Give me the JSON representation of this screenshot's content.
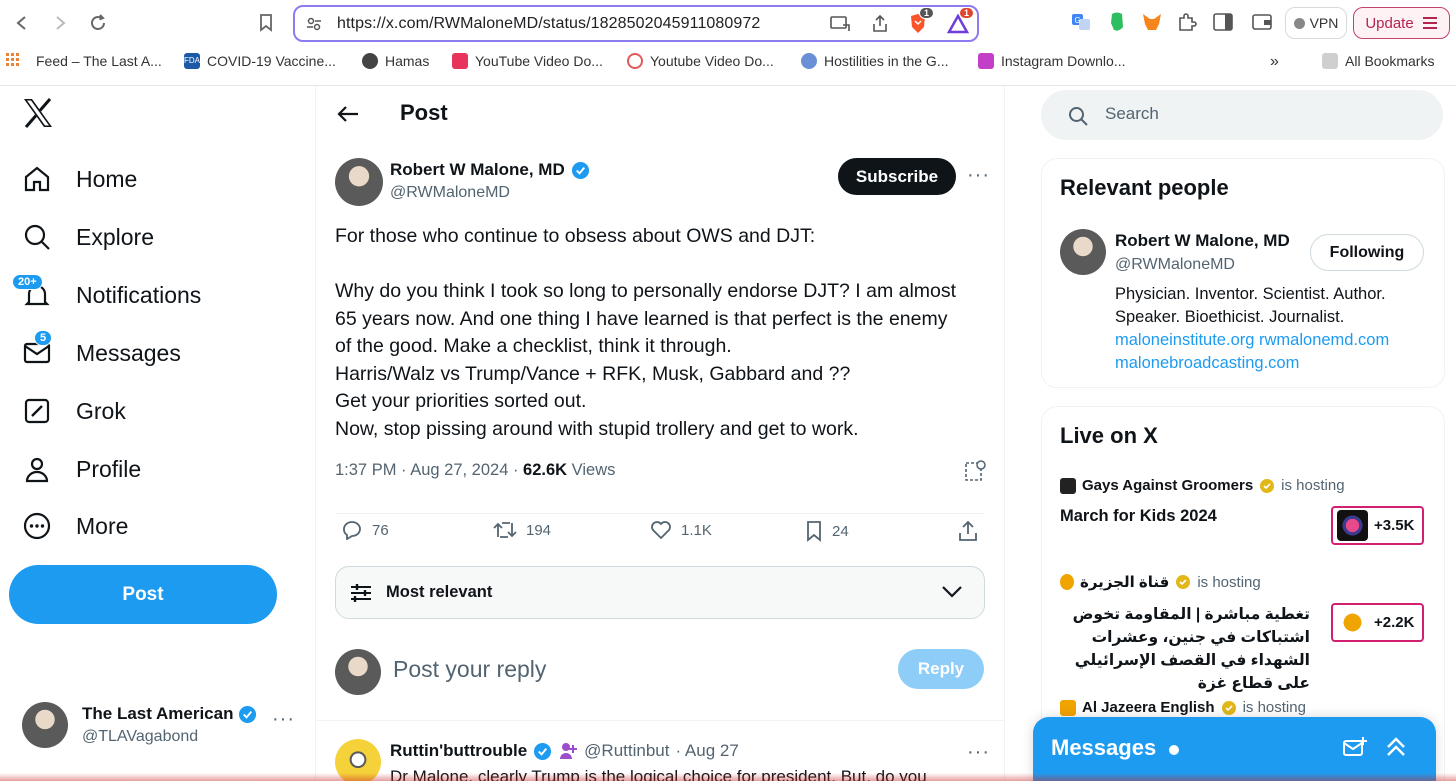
{
  "browser": {
    "url": "https://x.com/RWMaloneMD/status/1828502045911080972",
    "vpn_label": "VPN",
    "update_label": "Update",
    "brave_badge": "1",
    "rewards_badge": "1",
    "bookmarks": [
      {
        "label": "Feed – The Last A...",
        "color": "#e8833a"
      },
      {
        "label": "COVID-19 Vaccine...",
        "color": "#1c5aa6"
      },
      {
        "label": "Hamas",
        "color": "#444444"
      },
      {
        "label": "YouTube Video Do...",
        "color": "#e8335a"
      },
      {
        "label": "Youtube Video Do...",
        "color": "#e05a5a"
      },
      {
        "label": "Hostilities in the G...",
        "color": "#6a8fd6"
      },
      {
        "label": "Instagram Downlo...",
        "color": "#c43fc7"
      }
    ],
    "all_bookmarks": "All Bookmarks"
  },
  "nav": {
    "items": [
      {
        "label": "Home",
        "icon": "home-icon"
      },
      {
        "label": "Explore",
        "icon": "search-icon"
      },
      {
        "label": "Notifications",
        "icon": "bell-icon",
        "badge": "20+"
      },
      {
        "label": "Messages",
        "icon": "envelope-icon",
        "badge": "5"
      },
      {
        "label": "Grok",
        "icon": "grok-icon"
      },
      {
        "label": "Profile",
        "icon": "person-icon"
      },
      {
        "label": "More",
        "icon": "more-circle-icon"
      }
    ],
    "post_label": "Post",
    "account": {
      "name": "The Last American",
      "handle": "@TLAVagabond"
    }
  },
  "post": {
    "header_title": "Post",
    "author_name": "Robert W Malone, MD",
    "author_handle": "@RWMaloneMD",
    "subscribe_label": "Subscribe",
    "text": "For those who continue to obsess about OWS and DJT:\n\n  Why do you think I took so long to personally endorse DJT?  I am almost\n65 years now.  And one thing I have learned is that perfect is the enemy\nof the good.  Make a checklist, think it through.\nHarris/Walz vs Trump/Vance + RFK, Musk, Gabbard and ??\nGet your priorities sorted out.\nNow, stop pissing around with stupid trollery and get to work.",
    "time": "1:37 PM · Aug 27, 2024 · ",
    "views_count": "62.6K",
    "views_label": " Views",
    "stats": {
      "replies": "76",
      "reposts": "194",
      "likes": "1.1K",
      "bookmarks": "24"
    },
    "sort_label": "Most relevant",
    "reply_placeholder": "Post your reply",
    "reply_button": "Reply"
  },
  "reply_preview": {
    "name": "Ruttin'buttrouble",
    "handle": "@Ruttinbut",
    "date": "· Aug 27",
    "text": "Dr Malone, clearly Trump is the logical choice for president.  But, do you"
  },
  "sidebar": {
    "search_placeholder": "Search",
    "relevant": {
      "title": "Relevant people",
      "name": "Robert W Malone, MD",
      "handle": "@RWMaloneMD",
      "follow_label": "Following",
      "bio": "Physician. Inventor. Scientist. Author.\nSpeaker. Bioethicist. Journalist.",
      "link1": "maloneinstitute.org",
      "link2": "rwmalonemd.com",
      "link3": "malonebroadcasting.com"
    },
    "live": {
      "title": "Live on X",
      "items": [
        {
          "host": "Gays Against Groomers",
          "status": "is hosting",
          "title": "March for Kids 2024",
          "count": "+3.5K"
        },
        {
          "host": "قناة الجزيرة",
          "status": "is hosting",
          "title": "تغطية مباشرة | المقاومة تخوض اشتباكات في جنين، وعشرات الشهداء في القصف الإسرائيلي على قطاع غزة",
          "count": "+2.2K"
        },
        {
          "host": "Al Jazeera English",
          "status": "is hosting"
        }
      ]
    },
    "messages_label": "Messages"
  }
}
